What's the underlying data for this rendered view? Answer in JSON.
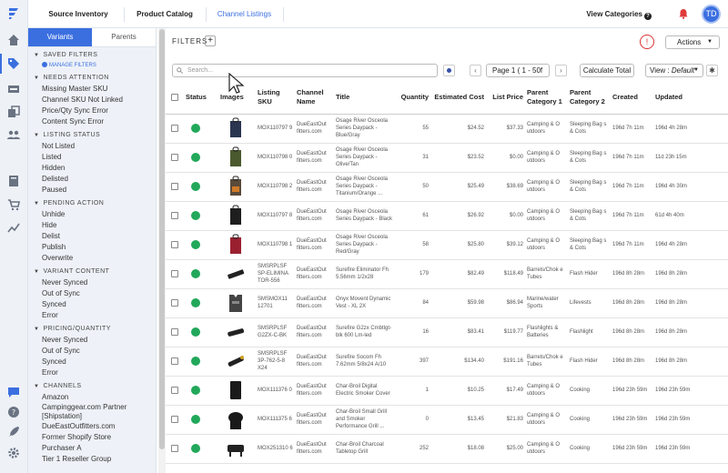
{
  "nav": {
    "tabs": [
      {
        "label": "Source Inventory"
      },
      {
        "label": "Product Catalog"
      },
      {
        "label": "Channel Listings"
      }
    ],
    "view_categories": "View Categories",
    "help_glyph": "?",
    "avatar_initials": "TD"
  },
  "sidebar": {
    "tabs": [
      "Variants",
      "Parents"
    ],
    "saved_filters": {
      "title": "SAVED FILTERS",
      "manage": "MANAGE FILTERS"
    },
    "needs_attention": {
      "title": "NEEDS ATTENTION",
      "items": [
        "Missing Master SKU",
        "Channel SKU Not Linked",
        "Price/Qty Sync Error",
        "Content Sync Error"
      ]
    },
    "listing_status": {
      "title": "LISTING STATUS",
      "items": [
        "Not Listed",
        "Listed",
        "Hidden",
        "Delisted",
        "Paused"
      ]
    },
    "pending_action": {
      "title": "PENDING ACTION",
      "items": [
        "Unhide",
        "Hide",
        "Delist",
        "Publish",
        "Overwrite"
      ]
    },
    "variant_content": {
      "title": "VARIANT CONTENT",
      "items": [
        "Never Synced",
        "Out of Sync",
        "Synced",
        "Error"
      ]
    },
    "pricing_quantity": {
      "title": "PRICING/QUANTITY",
      "items": [
        "Never Synced",
        "Out of Sync",
        "Synced",
        "Error"
      ]
    },
    "channels": {
      "title": "CHANNELS",
      "items": [
        "Amazon",
        "Campinggear.com Partner [Shipstation]",
        "DueEastOutfitters.com",
        "Former Shopify Store",
        "Purchaser A",
        "Tier 1 Reseller Group"
      ]
    }
  },
  "toolbar": {
    "filters_label": "FILTERS",
    "plus": "+",
    "warn_glyph": "!",
    "actions_label": "Actions",
    "search_placeholder": "Search...",
    "prev": "‹",
    "next": "›",
    "page_select": "Page 1 ( 1 - 50f",
    "calc_label": "Calculate Total",
    "view_prefix": "View :",
    "view_value": "Default",
    "gear_glyph": "✱"
  },
  "table": {
    "headers": {
      "status": "Status",
      "images": "Images",
      "sku": "Listing SKU",
      "channel": "Channel Name",
      "title": "Title",
      "quantity": "Quantity",
      "cost": "Estimated Cost",
      "price": "List Price",
      "cat1": "Parent Category 1",
      "cat2": "Parent Category 2",
      "created": "Created",
      "updated": "Updated"
    },
    "rows": [
      {
        "sku": "MOX110797 9",
        "channel": "DueEastOut fitters.com",
        "title": "Osage River Osceola Series Daypack - Blue/Gray",
        "qty": "55",
        "cost": "$24.52",
        "price": "$37.33",
        "cat1": "Camping & O utdoors",
        "cat2": "Sleeping Bag s & Cots",
        "created": "196d 7h 11m",
        "updated": "196d 4h 28m",
        "thumb": "backpack-blue"
      },
      {
        "sku": "MOX110798 0",
        "channel": "DueEastOut fitters.com",
        "title": "Osage River Osceola Series Daypack - Olive/Tan",
        "qty": "31",
        "cost": "$23.52",
        "price": "$0.00",
        "cat1": "Camping & O utdoors",
        "cat2": "Sleeping Bag s & Cots",
        "created": "196d 7h 11m",
        "updated": "11d 23h 15m",
        "thumb": "backpack-olive"
      },
      {
        "sku": "MOX110798 2",
        "channel": "DueEastOut fitters.com",
        "title": "Osage River Osceola Series Daypack - Titanium/Orange ...",
        "qty": "50",
        "cost": "$25.49",
        "price": "$38.69",
        "cat1": "Camping & O utdoors",
        "cat2": "Sleeping Bag s & Cots",
        "created": "196d 7h 11m",
        "updated": "196d 4h 30m",
        "thumb": "backpack-orange"
      },
      {
        "sku": "MOX110797 8",
        "channel": "DueEastOut fitters.com",
        "title": "Osage River Osceola Series Daypack - Black",
        "qty": "61",
        "cost": "$26.92",
        "price": "$0.00",
        "cat1": "Camping & O utdoors",
        "cat2": "Sleeping Bag s & Cots",
        "created": "196d 7h 11m",
        "updated": "61d 4h 40m",
        "thumb": "backpack-black"
      },
      {
        "sku": "MOX110798 1",
        "channel": "DueEastOut fitters.com",
        "title": "Osage River Osceola Series Daypack - Red/Gray",
        "qty": "58",
        "cost": "$25.80",
        "price": "$39.12",
        "cat1": "Camping & O utdoors",
        "cat2": "Sleeping Bag s & Cots",
        "created": "196d 7h 11m",
        "updated": "196d 4h 28m",
        "thumb": "backpack-red"
      },
      {
        "sku": "SMSRPLSF SP-ELIMINA TOR-556",
        "channel": "DueEastOut fitters.com",
        "title": "Surefire Eliminator Fh 5.56mm 1/2x28",
        "qty": "179",
        "cost": "$82.49",
        "price": "$118.49",
        "cat1": "Barrels/Chok e Tubes",
        "cat2": "Flash Hider",
        "created": "196d 8h 28m",
        "updated": "196d 8h 28m",
        "thumb": "flashhider"
      },
      {
        "sku": "SMSMOX11 12701",
        "channel": "DueEastOut fitters.com",
        "title": "Onyx Movent Dynamic Vest - XL 2X",
        "qty": "84",
        "cost": "$59.98",
        "price": "$86.94",
        "cat1": "Marine/water Sports",
        "cat2": "Lifevests",
        "created": "196d 8h 28m",
        "updated": "196d 8h 28m",
        "thumb": "vest"
      },
      {
        "sku": "SMSRPLSF G2ZX-C-BK",
        "channel": "DueEastOut fitters.com",
        "title": "Surefire G2zx Cmbtlgt-blk 600 Lm-led",
        "qty": "16",
        "cost": "$83.41",
        "price": "$119.77",
        "cat1": "Flashlights & Batteries",
        "cat2": "Flashlight",
        "created": "196d 8h 28m",
        "updated": "196d 8h 28m",
        "thumb": "flashlight"
      },
      {
        "sku": "SMSRPLSF 3P-762-5-8 X24",
        "channel": "DueEastOut fitters.com",
        "title": "Surefire Socom Fh 7.62mm 5/8x24 A/10",
        "qty": "397",
        "cost": "$134.40",
        "price": "$191.16",
        "cat1": "Barrels/Chok e Tubes",
        "cat2": "Flash Hider",
        "created": "196d 8h 28m",
        "updated": "196d 8h 28m",
        "thumb": "flashlight2"
      },
      {
        "sku": "MOX111376 0",
        "channel": "DueEastOut fitters.com",
        "title": "Char-Broil Digital Electric Smoker Cover",
        "qty": "1",
        "cost": "$10.25",
        "price": "$17.49",
        "cat1": "Camping & O utdoors",
        "cat2": "Cooking",
        "created": "196d 23h 59m",
        "updated": "196d 23h 59m",
        "thumb": "cover"
      },
      {
        "sku": "MOX111375 6",
        "channel": "DueEastOut fitters.com",
        "title": "Char-Broil Small Grill and Smoker Performance Grill ...",
        "qty": "0",
        "cost": "$13.45",
        "price": "$21.83",
        "cat1": "Camping & O utdoors",
        "cat2": "Cooking",
        "created": "196d 23h 59m",
        "updated": "196d 23h 59m",
        "thumb": "grillcover"
      },
      {
        "sku": "MOX251310 6",
        "channel": "DueEastOut fitters.com",
        "title": "Char-Broil Charcoal Tabletop Grill",
        "qty": "252",
        "cost": "$18.08",
        "price": "$25.00",
        "cat1": "Camping & O utdoors",
        "cat2": "Cooking",
        "created": "196d 23h 59m",
        "updated": "196d 23h 59m",
        "thumb": "grill"
      }
    ]
  },
  "colors": {
    "accent": "#3b6fe0",
    "status_ok": "#22a85a",
    "alert": "#dd3333"
  }
}
